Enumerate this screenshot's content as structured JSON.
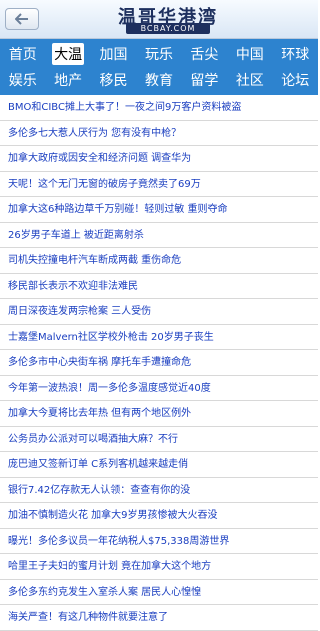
{
  "header": {
    "logo_title": "温哥华港湾",
    "logo_subtitle": "BCBAY.COM",
    "back_icon": "back-arrow-icon"
  },
  "nav": {
    "active": "大温",
    "rows": [
      [
        "首页",
        "大温",
        "加国",
        "玩乐",
        "舌尖",
        "中国",
        "环球"
      ],
      [
        "娱乐",
        "地产",
        "移民",
        "教育",
        "留学",
        "社区",
        "论坛"
      ]
    ]
  },
  "articles": [
    "BMO和CIBC摊上大事了！一夜之间9万客户资料被盗",
    "多伦多七大惹人厌行为 您有没有中枪？",
    "加拿大政府或因安全和经济问题 调查华为",
    "天呢！这个无门无窗的破房子竟然卖了69万",
    "加拿大这6种路边草千万别碰！轻则过敏 重则夺命",
    "26岁男子车道上 被近距离射杀",
    "司机失控撞电杆汽车断成两截 重伤命危",
    "移民部长表示不欢迎非法难民",
    "周日深夜连发两宗枪案 三人受伤",
    "士嘉堡Malvern社区学校外枪击 20岁男子丧生",
    "多伦多市中心央街车祸 摩托车手遭撞命危",
    "今年第一波热浪！周一多伦多温度感觉近40度",
    "加拿大今夏将比去年热 但有两个地区例外",
    "公务员办公派对可以喝酒抽大麻？不行",
    "庞巴迪又签新订单 C系列客机越来越走俏",
    "银行7.42亿存款无人认领：查查有你的没",
    "加油不慎制造火花 加拿大9岁男孩惨被大火吞没",
    "曝光！多伦多议员一年花纳税人$75,338周游世界",
    "哈里王子夫妇的蜜月计划 竟在加拿大这个地方",
    "多伦多东约克发生入室杀人案 居民人心惶惶",
    "海关严查！有这几种物件就要注意了"
  ]
}
